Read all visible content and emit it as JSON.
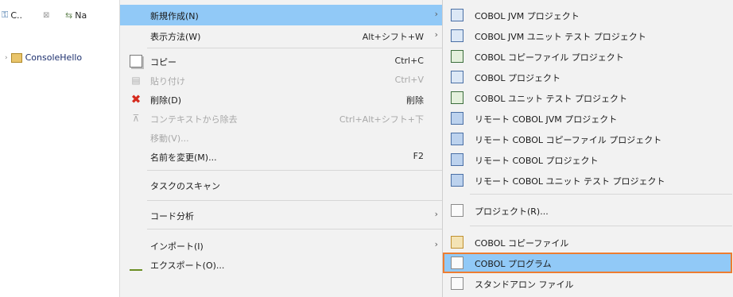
{
  "left_view": {
    "tabs": [
      {
        "label": "C..",
        "icon": "explorer-icon"
      },
      {
        "label": "⊠",
        "icon": "close-icon"
      },
      {
        "label": "Na",
        "icon": "navigator-icon"
      }
    ],
    "tree_item": "ConsoleHello"
  },
  "context_menu": {
    "items": [
      {
        "label": "新規作成(N)",
        "accelerator": "",
        "submenu": true,
        "highlighted": true,
        "icon": ""
      },
      {
        "label": "表示方法(W)",
        "accelerator": "Alt+シフト+W",
        "submenu": true,
        "icon": ""
      },
      {
        "label": "コピー",
        "accelerator": "Ctrl+C",
        "icon": "copy-icon"
      },
      {
        "label": "貼り付け",
        "accelerator": "Ctrl+V",
        "disabled": true,
        "icon": "paste-icon"
      },
      {
        "label": "削除(D)",
        "accelerator": "削除",
        "icon": "delete-icon"
      },
      {
        "label": "コンテキストから除去",
        "accelerator": "Ctrl+Alt+シフト+下",
        "disabled": true,
        "icon": "remove-context-icon"
      },
      {
        "label": "移動(V)...",
        "accelerator": "",
        "disabled": true,
        "icon": ""
      },
      {
        "label": "名前を変更(M)...",
        "accelerator": "F2",
        "icon": ""
      },
      {
        "label": "タスクのスキャン",
        "accelerator": "",
        "icon": ""
      },
      {
        "label": "コード分析",
        "accelerator": "",
        "submenu": true,
        "icon": ""
      },
      {
        "label": "インポート(I)",
        "accelerator": "",
        "submenu": true,
        "icon": ""
      },
      {
        "label": "エクスポート(O)...",
        "accelerator": "",
        "icon": "export-icon"
      }
    ]
  },
  "submenu": {
    "items": [
      {
        "label": "COBOL JVM プロジェクト",
        "icon": "jvm-project-icon"
      },
      {
        "label": "COBOL JVM ユニット テスト プロジェクト",
        "icon": "jvm-unit-test-project-icon"
      },
      {
        "label": "COBOL コピーファイル プロジェクト",
        "icon": "copyfile-project-icon"
      },
      {
        "label": "COBOL プロジェクト",
        "icon": "cobol-project-icon"
      },
      {
        "label": "COBOL ユニット テスト プロジェクト",
        "icon": "unit-test-project-icon"
      },
      {
        "label": "リモート COBOL JVM プロジェクト",
        "icon": "remote-jvm-project-icon"
      },
      {
        "label": "リモート COBOL コピーファイル プロジェクト",
        "icon": "remote-copyfile-project-icon"
      },
      {
        "label": "リモート COBOL プロジェクト",
        "icon": "remote-project-icon"
      },
      {
        "label": "リモート COBOL ユニット テスト プロジェクト",
        "icon": "remote-unit-test-project-icon"
      },
      {
        "label": "プロジェクト(R)...",
        "icon": "project-icon"
      },
      {
        "label": "COBOL コピーファイル",
        "icon": "copyfile-icon"
      },
      {
        "label": "COBOL プログラム",
        "highlighted": true,
        "icon": "cobol-program-icon"
      },
      {
        "label": "スタンドアロン ファイル",
        "icon": "standalone-file-icon"
      }
    ]
  },
  "colors": {
    "menu_bg": "#f2f2f2",
    "highlight": "#91c9f7",
    "focus_outline": "#ed7d31"
  }
}
